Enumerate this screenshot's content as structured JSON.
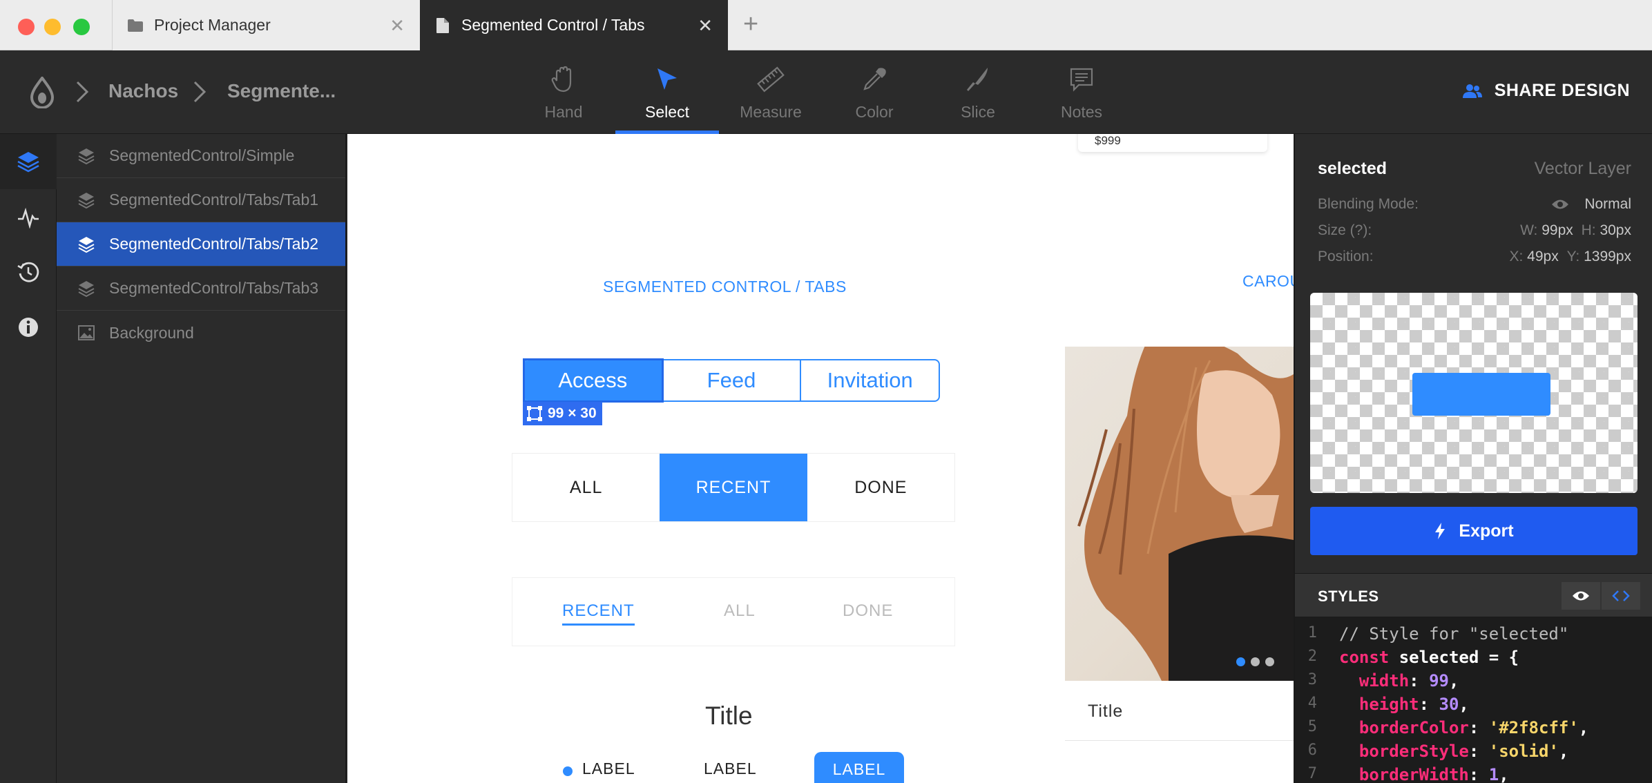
{
  "tabs": [
    {
      "label": "Project Manager"
    },
    {
      "label": "Segmented Control / Tabs"
    }
  ],
  "breadcrumb": [
    "Nachos",
    "Segmente..."
  ],
  "tools": [
    {
      "label": "Hand",
      "icon": "hand-icon"
    },
    {
      "label": "Select",
      "icon": "cursor-icon",
      "active": true
    },
    {
      "label": "Measure",
      "icon": "ruler-icon"
    },
    {
      "label": "Color",
      "icon": "eyedropper-icon"
    },
    {
      "label": "Slice",
      "icon": "knife-icon"
    },
    {
      "label": "Notes",
      "icon": "comment-icon"
    }
  ],
  "share_label": "SHARE DESIGN",
  "layers": [
    {
      "label": "SegmentedControl/Simple"
    },
    {
      "label": "SegmentedControl/Tabs/Tab1"
    },
    {
      "label": "SegmentedControl/Tabs/Tab2",
      "selected": true
    },
    {
      "label": "SegmentedControl/Tabs/Tab3"
    },
    {
      "label": "Background"
    }
  ],
  "canvas": {
    "price": "$999",
    "section_title": "SEGMENTED CONTROL / TABS",
    "carousel_title": "CAROUSEL",
    "seg1": [
      "Access",
      "Feed",
      "Invitation"
    ],
    "dim_badge": "99 × 30",
    "seg2": [
      "ALL",
      "RECENT",
      "DONE"
    ],
    "seg3": [
      "RECENT",
      "ALL",
      "DONE"
    ],
    "title": "Title",
    "labels": [
      "LABEL",
      "LABEL",
      "LABEL"
    ],
    "card_title": "Title"
  },
  "inspector": {
    "name": "selected",
    "type": "Vector Layer",
    "blending_label": "Blending Mode:",
    "blending_value": "Normal",
    "size_label": "Size (?):",
    "w_key": "W:",
    "w_val": "99px",
    "h_key": "H:",
    "h_val": "30px",
    "position_label": "Position:",
    "x_key": "X:",
    "x_val": "49px",
    "y_key": "Y:",
    "y_val": "1399px",
    "export_label": "Export",
    "styles_title": "STYLES"
  },
  "code": [
    {
      "n": "1",
      "comment": "// Style for \"selected\""
    },
    {
      "n": "2",
      "kw": "const",
      "ident": " selected = {"
    },
    {
      "n": "3",
      "key": "  width",
      "sep": ": ",
      "num": "99",
      "end": ","
    },
    {
      "n": "4",
      "key": "  height",
      "sep": ": ",
      "num": "30",
      "end": ","
    },
    {
      "n": "5",
      "key": "  borderColor",
      "sep": ": ",
      "str": "'#2f8cff'",
      "end": ","
    },
    {
      "n": "6",
      "key": "  borderStyle",
      "sep": ": ",
      "str": "'solid'",
      "end": ","
    },
    {
      "n": "7",
      "key": "  borderWidth",
      "sep": ": ",
      "num": "1",
      "end": ","
    }
  ],
  "colors": {
    "accent": "#2f8cff",
    "selection": "#2557b9",
    "export": "#1f5bf0"
  }
}
